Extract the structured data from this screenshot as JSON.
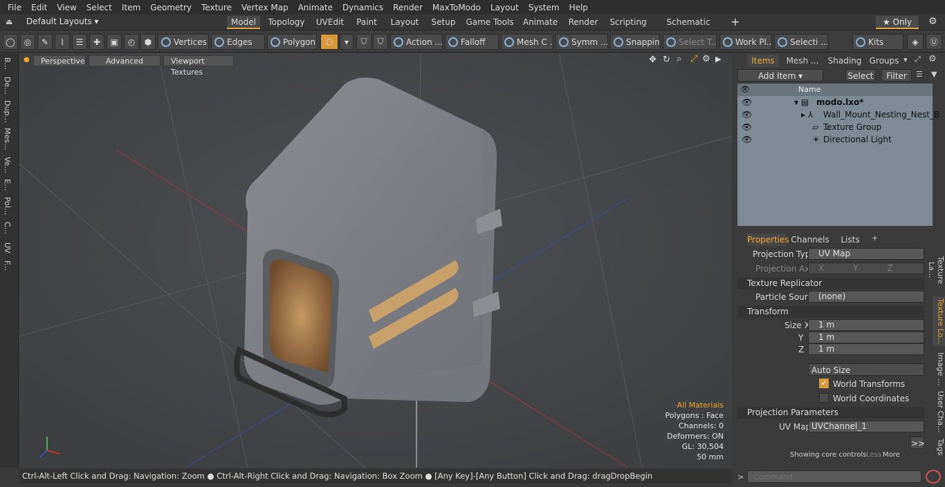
{
  "menu": [
    "File",
    "Edit",
    "View",
    "Select",
    "Item",
    "Geometry",
    "Texture",
    "Vertex Map",
    "Animate",
    "Dynamics",
    "Render",
    "MaxToModo",
    "Layout",
    "System",
    "Help"
  ],
  "layout_select": "Default Layouts ▾",
  "layout_tabs": [
    "Model",
    "Topology",
    "UVEdit",
    "Paint",
    "Layout",
    "Setup",
    "Game Tools",
    "Animate",
    "Render",
    "Scripting",
    "Schematic Fusion"
  ],
  "plus": "+",
  "only_label": "★ Only",
  "toolbar": {
    "vertices": "Vertices",
    "edges": "Edges",
    "polygons": "Polygons",
    "action": "Action ...",
    "falloff": "Falloff",
    "mesh": "Mesh C ...",
    "symm": "Symm ...",
    "snapping": "Snapping",
    "select_t": "Select T...",
    "work_pl": "Work Pl...",
    "selecti": "Selecti ...",
    "kits": "Kits"
  },
  "left_tabs": [
    "B...",
    "De...",
    "Dup...",
    "Mes...",
    "Ve...",
    "E...",
    "Pol...",
    "C...",
    "UV",
    "F..."
  ],
  "viewport": {
    "view": "Perspective",
    "shading": "Advanced",
    "textures": "Viewport Textures",
    "info": {
      "all_materials": "All Materials",
      "polygons": "Polygons : Face",
      "channels": "Channels: 0",
      "deformers": "Deformers: ON",
      "gl": "GL: 30,504",
      "scale": "50 mm"
    }
  },
  "status": "Ctrl-Alt-Left Click and Drag: Navigation: Zoom ● Ctrl-Alt-Right Click and Drag: Navigation: Box Zoom ● [Any Key]-[Any Button] Click and Drag: dragDropBegin",
  "right": {
    "tabs": [
      "Items",
      "Mesh ...",
      "Shading",
      "Groups"
    ],
    "add_item": "Add Item",
    "select": "Select",
    "filter": "Filter",
    "col_name": "Name",
    "items": [
      "modo.lxo*",
      "Wall_Mount_Nesting_Nest_B ...",
      "Texture Group",
      "Directional Light"
    ],
    "prop_tabs": [
      "Properties",
      "Channels",
      "Lists"
    ],
    "projection_type_label": "Projection Type",
    "projection_type": "UV Map",
    "projection_axis_label": "Projection Axis",
    "axis": [
      "X",
      "Y",
      "Z"
    ],
    "texture_replicator": "Texture Replicator",
    "particle_source_label": "Particle Source",
    "particle_source": "(none)",
    "transform": "Transform",
    "size_labels": [
      "Size X",
      "Y",
      "Z"
    ],
    "size_values": [
      "1 m",
      "1 m",
      "1 m"
    ],
    "auto_size": "Auto Size",
    "world_transforms": "World Transforms",
    "world_coordinates": "World Coordinates",
    "projection_params": "Projection Parameters",
    "uv_map_label": "UV Map",
    "uv_map": "UVChannel_1",
    "more_btn": ">>",
    "showing": "Showing core controls",
    "less": "Less",
    "more": "More",
    "side_tabs": [
      "Texture La...",
      "Texture Lo...",
      "Image ...",
      "User Cha...",
      "Tags"
    ],
    "command_placeholder": "Command"
  }
}
